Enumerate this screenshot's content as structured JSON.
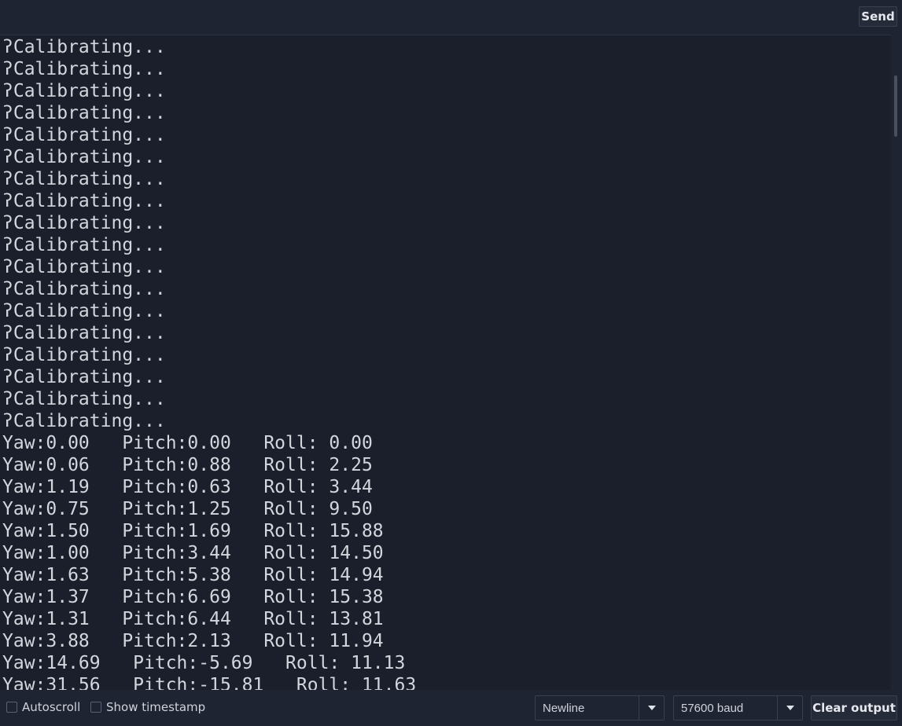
{
  "top": {
    "send_input_value": "",
    "send_label": "Send"
  },
  "output": {
    "lines": [
      "ʔCalibrating...",
      "ʔCalibrating...",
      "ʔCalibrating...",
      "ʔCalibrating...",
      "ʔCalibrating...",
      "ʔCalibrating...",
      "ʔCalibrating...",
      "ʔCalibrating...",
      "ʔCalibrating...",
      "ʔCalibrating...",
      "ʔCalibrating...",
      "ʔCalibrating...",
      "ʔCalibrating...",
      "ʔCalibrating...",
      "ʔCalibrating...",
      "ʔCalibrating...",
      "ʔCalibrating...",
      "ʔCalibrating...",
      "Yaw:0.00   Pitch:0.00   Roll: 0.00",
      "Yaw:0.06   Pitch:0.88   Roll: 2.25",
      "Yaw:1.19   Pitch:0.63   Roll: 3.44",
      "Yaw:0.75   Pitch:1.25   Roll: 9.50",
      "Yaw:1.50   Pitch:1.69   Roll: 15.88",
      "Yaw:1.00   Pitch:3.44   Roll: 14.50",
      "Yaw:1.63   Pitch:5.38   Roll: 14.94",
      "Yaw:1.37   Pitch:6.69   Roll: 15.38",
      "Yaw:1.31   Pitch:6.44   Roll: 13.81",
      "Yaw:3.88   Pitch:2.13   Roll: 11.94",
      "Yaw:14.69   Pitch:-5.69   Roll: 11.13",
      "Yaw:31.56   Pitch:-15.81   Roll: 11.63"
    ]
  },
  "bottom": {
    "autoscroll_label": "Autoscroll",
    "autoscroll_checked": false,
    "timestamp_label": "Show timestamp",
    "timestamp_checked": false,
    "line_ending_value": "Newline",
    "baud_value": "57600 baud",
    "clear_label": "Clear output"
  },
  "colors": {
    "background": "#1f2432",
    "output_background": "#1b1f2b",
    "text": "#d3d6dc"
  },
  "icons": {
    "dropdown": "chevron-down-icon"
  }
}
